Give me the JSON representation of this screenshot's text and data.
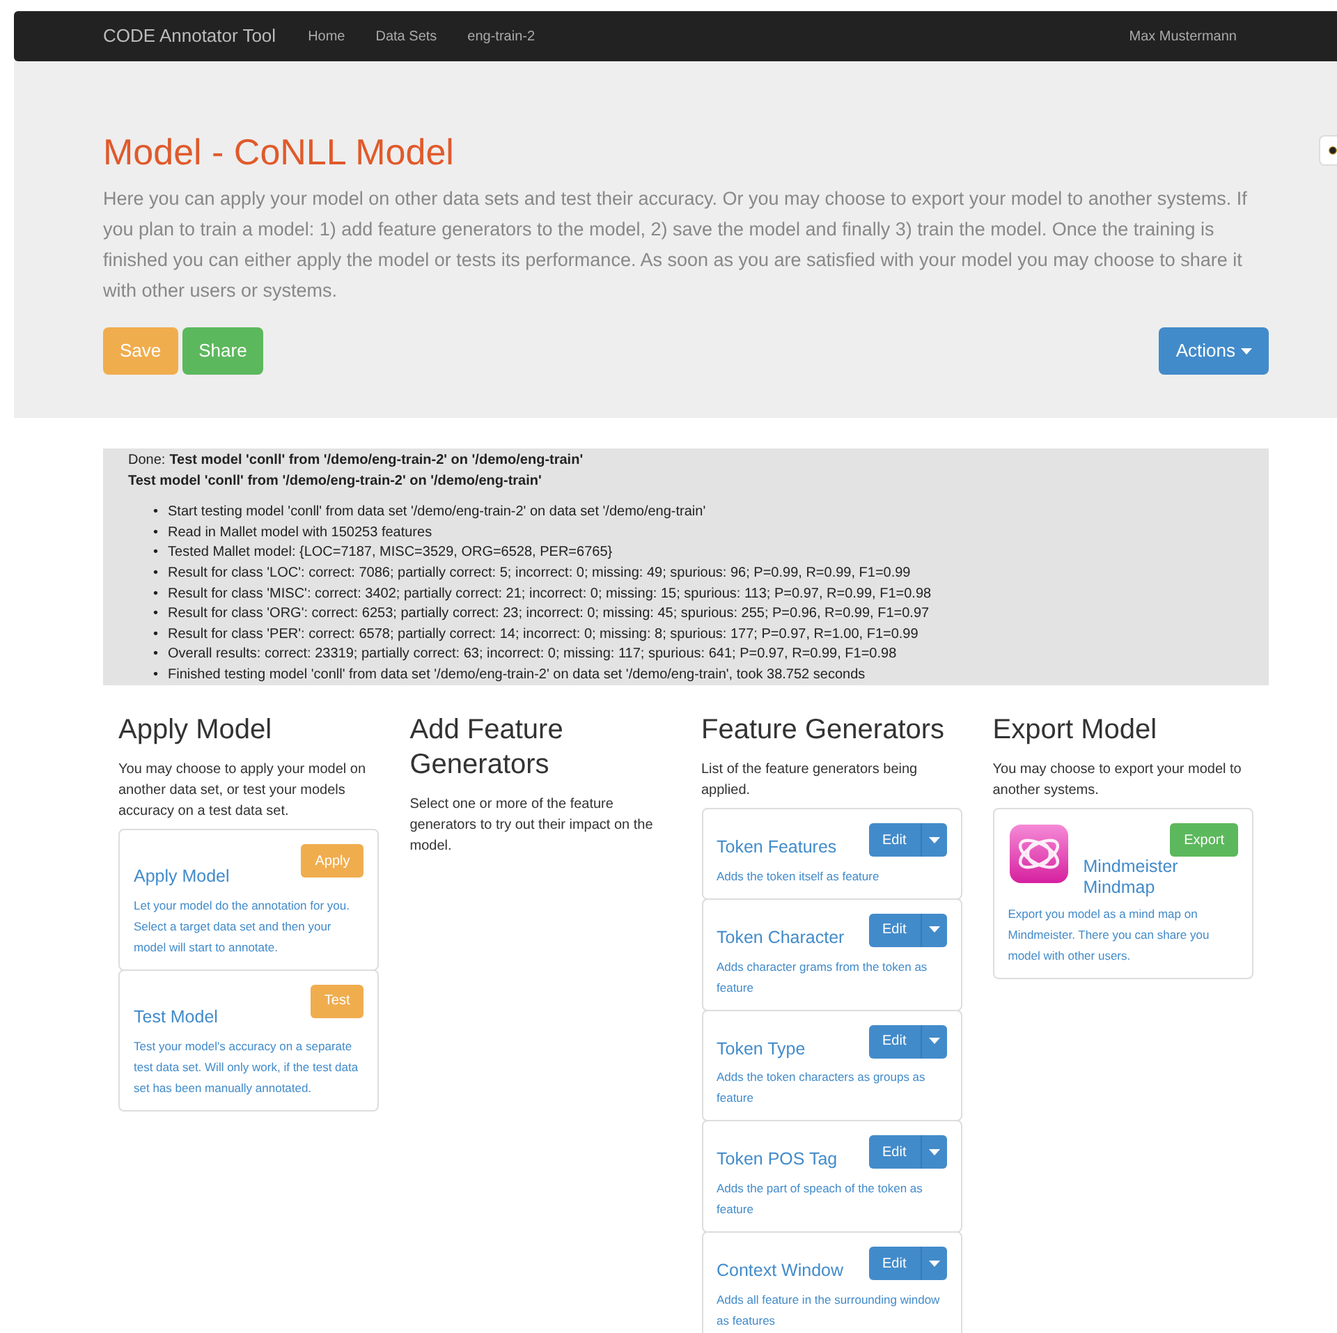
{
  "navbar": {
    "brand": "CODE Annotator Tool",
    "links": [
      "Home",
      "Data Sets",
      "eng-train-2"
    ],
    "user": "Max Mustermann"
  },
  "hero": {
    "title": "Model - CoNLL Model",
    "description": "Here you can apply your model on other data sets and test their accuracy. Or you may choose to export your model to another systems. If you plan to train a model: 1) add feature generators to the model, 2) save the model and finally 3) train the model. Once the training is finished you can either apply the model or tests its performance. As soon as you are satisfied with your model you may choose to share it with other users or systems.",
    "buttons": [
      {
        "label": "Save",
        "kind": "warning"
      },
      {
        "label": "Share",
        "kind": "success"
      }
    ],
    "actions": "Actions"
  },
  "log": {
    "marker": "•",
    "status": "Done:",
    "task": "Test model 'conll' from '/demo/eng-train-2' on '/demo/eng-train'",
    "title": "Test model 'conll' from '/demo/eng-train-2' on '/demo/eng-train'",
    "items": [
      "Start testing model 'conll' from data set '/demo/eng-train-2' on data set '/demo/eng-train'",
      "Read in Mallet model with 150253 features",
      "Tested Mallet model: {LOC=7187, MISC=3529, ORG=6528, PER=6765}",
      "Result for class 'LOC': correct: 7086; partially correct: 5; incorrect: 0; missing: 49; spurious: 96; P=0.99, R=0.99, F1=0.99",
      "Result for class 'MISC': correct: 3402; partially correct: 21; incorrect: 0; missing: 15; spurious: 113; P=0.97, R=0.99, F1=0.98",
      "Result for class 'ORG': correct: 6253; partially correct: 23; incorrect: 0; missing: 45; spurious: 255; P=0.96, R=0.99, F1=0.97",
      "Result for class 'PER': correct: 6578; partially correct: 14; incorrect: 0; missing: 8; spurious: 177; P=0.97, R=1.00, F1=0.99",
      "Overall results: correct: 23319; partially correct: 63; incorrect: 0; missing: 117; spurious: 641; P=0.97, R=0.99, F1=0.98",
      "Finished testing model 'conll' from data set '/demo/eng-train-2' on data set '/demo/eng-train', took 38.752 seconds"
    ]
  },
  "sections": [
    {
      "title": "Apply Model",
      "description": "You may choose to apply your model on another data set, or test your models accuracy on a test data set.",
      "cards": [
        {
          "kind": "action",
          "title": "Apply Model",
          "button": "Apply",
          "description": "Let your model do the annotation for you. Select a target data set and then your model will start to annotate."
        },
        {
          "kind": "action",
          "title": "Test Model",
          "button": "Test",
          "description": "Test your model's accuracy on a separate test data set. Will only work, if the test data set has been manually annotated."
        }
      ]
    },
    {
      "title": "Add Feature Generators",
      "description": "Select one or more of the feature generators to try out their impact on the model."
    },
    {
      "title": "Feature Generators",
      "description": "List of the feature generators being applied.",
      "cards": [
        {
          "kind": "generator",
          "title": "Token Features",
          "button": "Edit",
          "description": "Adds the token itself as feature"
        },
        {
          "kind": "generator",
          "title": "Token Character",
          "button": "Edit",
          "description": "Adds character grams from the token as feature"
        },
        {
          "kind": "generator",
          "title": "Token Type",
          "button": "Edit",
          "description": "Adds the token characters as groups as feature"
        },
        {
          "kind": "generator",
          "title": "Token POS Tag",
          "button": "Edit",
          "description": "Adds the part of speach of the token as feature"
        },
        {
          "kind": "generator",
          "title": "Context Window",
          "button": "Edit",
          "description": "Adds all feature in the surrounding window as features"
        }
      ]
    },
    {
      "title": "Export Model",
      "description": "You may choose to export your model to another systems.",
      "cards": [
        {
          "kind": "export",
          "title": "Mindmeister Mindmap",
          "button": "Export",
          "description": "Export you model as a mind map on Mindmeister. There you can share you model with other users."
        }
      ]
    }
  ]
}
